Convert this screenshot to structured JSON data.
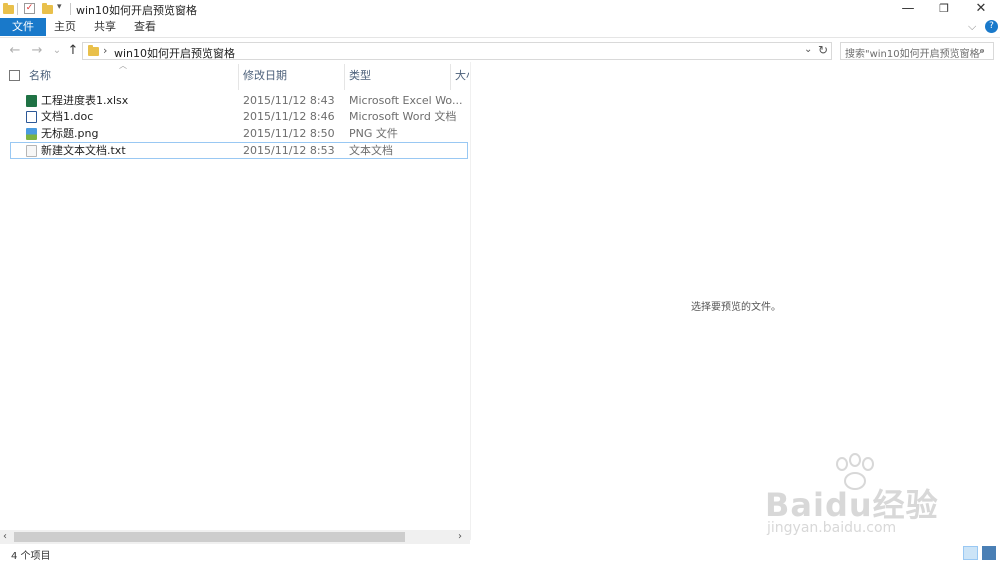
{
  "window": {
    "title": "win10如何开启预览窗格",
    "minimize_glyph": "—",
    "restore_glyph": "❐",
    "close_glyph": "✕"
  },
  "ribbon": {
    "tabs": [
      "文件",
      "主页",
      "共享",
      "查看"
    ],
    "help_glyph": "?",
    "expand_glyph": "⌵"
  },
  "nav": {
    "back_glyph": "←",
    "forward_glyph": "→",
    "recent_glyph": "⌄",
    "up_glyph": "↑",
    "path": "win10如何开启预览窗格",
    "search_placeholder": "搜索\"win10如何开启预览窗格\"",
    "refresh_glyph": "↻"
  },
  "columns": [
    "名称",
    "修改日期",
    "类型",
    "大小"
  ],
  "files": [
    {
      "name": "工程进度表1.xlsx",
      "date": "2015/11/12 8:43",
      "type": "Microsoft Excel Wo...",
      "icon": "excel-file-icon",
      "icon_color": "#1f7244"
    },
    {
      "name": "文档1.doc",
      "date": "2015/11/12 8:46",
      "type": "Microsoft Word 文档",
      "icon": "word-file-icon",
      "icon_color": "#2b5797"
    },
    {
      "name": "无标题.png",
      "date": "2015/11/12 8:50",
      "type": "PNG 文件",
      "icon": "image-file-icon",
      "icon_color": "#4a9be0"
    },
    {
      "name": "新建文本文档.txt",
      "date": "2015/11/12 8:53",
      "type": "文本文档",
      "icon": "text-file-icon",
      "icon_color": "#dcdcdc"
    }
  ],
  "preview": {
    "message": "选择要预览的文件。"
  },
  "status": {
    "item_count": "4 个项目"
  },
  "watermark": {
    "brand": "Baidu经验",
    "url": "jingyan.baidu.com"
  },
  "colors": {
    "accent": "#1979ca",
    "selection_border": "#99c8f3",
    "folder": "#e9c04b"
  }
}
